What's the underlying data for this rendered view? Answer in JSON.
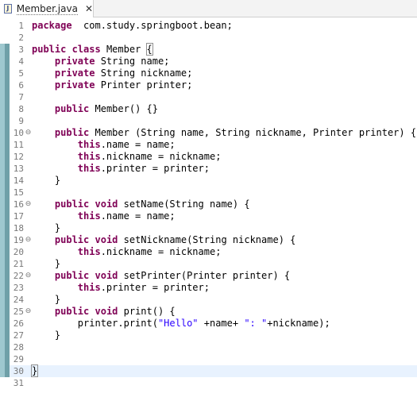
{
  "tab": {
    "label": "Member.java",
    "icon": "java-file-icon",
    "close_icon": "close-icon",
    "close_glyph": "✕",
    "icon_text": "J"
  },
  "editor": {
    "lines": [
      {
        "n": "1",
        "segs": [
          [
            "kw",
            "package"
          ],
          [
            "",
            "  com.study.springboot.bean;"
          ]
        ]
      },
      {
        "n": "2",
        "segs": []
      },
      {
        "n": "3",
        "segs": [
          [
            "kw",
            "public"
          ],
          [
            "",
            " "
          ],
          [
            "kw",
            "class"
          ],
          [
            "",
            " Member "
          ],
          [
            "bracket",
            "{"
          ]
        ]
      },
      {
        "n": "4",
        "segs": [
          [
            "",
            "    "
          ],
          [
            "kw",
            "private"
          ],
          [
            "",
            " String name;"
          ]
        ]
      },
      {
        "n": "5",
        "segs": [
          [
            "",
            "    "
          ],
          [
            "kw",
            "private"
          ],
          [
            "",
            " String nickname;"
          ]
        ]
      },
      {
        "n": "6",
        "segs": [
          [
            "",
            "    "
          ],
          [
            "kw",
            "private"
          ],
          [
            "",
            " Printer printer;"
          ]
        ]
      },
      {
        "n": "7",
        "segs": []
      },
      {
        "n": "8",
        "segs": [
          [
            "",
            "    "
          ],
          [
            "kw",
            "public"
          ],
          [
            "",
            " Member() {}"
          ]
        ]
      },
      {
        "n": "9",
        "segs": []
      },
      {
        "n": "10",
        "fold": true,
        "segs": [
          [
            "",
            "    "
          ],
          [
            "kw",
            "public"
          ],
          [
            "",
            " Member (String name, String nickname, Printer printer) {"
          ]
        ]
      },
      {
        "n": "11",
        "segs": [
          [
            "",
            "        "
          ],
          [
            "kw",
            "this"
          ],
          [
            "",
            ".name = name;"
          ]
        ]
      },
      {
        "n": "12",
        "segs": [
          [
            "",
            "        "
          ],
          [
            "kw",
            "this"
          ],
          [
            "",
            ".nickname = nickname;"
          ]
        ]
      },
      {
        "n": "13",
        "segs": [
          [
            "",
            "        "
          ],
          [
            "kw",
            "this"
          ],
          [
            "",
            ".printer = printer;"
          ]
        ]
      },
      {
        "n": "14",
        "segs": [
          [
            "",
            "    }"
          ]
        ]
      },
      {
        "n": "15",
        "segs": []
      },
      {
        "n": "16",
        "fold": true,
        "segs": [
          [
            "",
            "    "
          ],
          [
            "kw",
            "public"
          ],
          [
            "",
            " "
          ],
          [
            "kw",
            "void"
          ],
          [
            "",
            " setName(String name) {"
          ]
        ]
      },
      {
        "n": "17",
        "segs": [
          [
            "",
            "        "
          ],
          [
            "kw",
            "this"
          ],
          [
            "",
            ".name = name;"
          ]
        ]
      },
      {
        "n": "18",
        "segs": [
          [
            "",
            "    }"
          ]
        ]
      },
      {
        "n": "19",
        "fold": true,
        "segs": [
          [
            "",
            "    "
          ],
          [
            "kw",
            "public"
          ],
          [
            "",
            " "
          ],
          [
            "kw",
            "void"
          ],
          [
            "",
            " setNickname(String nickname) {"
          ]
        ]
      },
      {
        "n": "20",
        "segs": [
          [
            "",
            "        "
          ],
          [
            "kw",
            "this"
          ],
          [
            "",
            ".nickname = nickname;"
          ]
        ]
      },
      {
        "n": "21",
        "segs": [
          [
            "",
            "    }"
          ]
        ]
      },
      {
        "n": "22",
        "fold": true,
        "segs": [
          [
            "",
            "    "
          ],
          [
            "kw",
            "public"
          ],
          [
            "",
            " "
          ],
          [
            "kw",
            "void"
          ],
          [
            "",
            " setPrinter(Printer printer) {"
          ]
        ]
      },
      {
        "n": "23",
        "segs": [
          [
            "",
            "        "
          ],
          [
            "kw",
            "this"
          ],
          [
            "",
            ".printer = printer;"
          ]
        ]
      },
      {
        "n": "24",
        "segs": [
          [
            "",
            "    }"
          ]
        ]
      },
      {
        "n": "25",
        "fold": true,
        "segs": [
          [
            "",
            "    "
          ],
          [
            "kw",
            "public"
          ],
          [
            "",
            " "
          ],
          [
            "kw",
            "void"
          ],
          [
            "",
            " print() {"
          ]
        ]
      },
      {
        "n": "26",
        "segs": [
          [
            "",
            "        printer.print("
          ],
          [
            "str",
            "\"Hello\""
          ],
          [
            "",
            " +name+ "
          ],
          [
            "str",
            "\": \""
          ],
          [
            "",
            "+nickname);"
          ]
        ]
      },
      {
        "n": "27",
        "segs": [
          [
            "",
            "    }"
          ]
        ]
      },
      {
        "n": "28",
        "segs": []
      },
      {
        "n": "29",
        "segs": []
      },
      {
        "n": "30",
        "current": true,
        "caret": true,
        "segs": [
          [
            "bracket",
            "}"
          ]
        ]
      },
      {
        "n": "31",
        "segs": []
      }
    ],
    "fold_glyph": "⊖",
    "colors": {
      "keyword": "#7f0055",
      "string": "#2a00ff",
      "line_number": "#787878",
      "current_line": "#e8f2fe",
      "change_ruler": "#9ec8cf"
    }
  }
}
